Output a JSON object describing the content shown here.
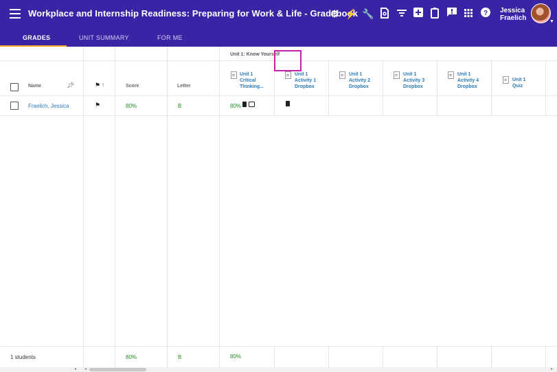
{
  "app": {
    "title": "Workplace and Internship Readiness: Preparing for Work & Life - Gradebook",
    "user_first": "Jessica",
    "user_last": "Fraelich"
  },
  "toolbar_icons": [
    "settings-icon",
    "lightning-icon",
    "wrench-icon",
    "search-doc-icon",
    "filter-icon",
    "add-box-icon",
    "clipboard-icon",
    "feedback-icon",
    "apps-grid-icon",
    "help-icon"
  ],
  "tabs": [
    {
      "label": "GRADES",
      "active": true
    },
    {
      "label": "UNIT SUMMARY",
      "active": false
    },
    {
      "label": "FOR ME",
      "active": false
    }
  ],
  "headers": {
    "name": "Name",
    "score": "Score",
    "letter": "Letter",
    "unit_group": "Unit 1: Know Yourself"
  },
  "columns": [
    {
      "label": "Unit 1 Critical Thinking...",
      "lines": [
        "Unit 1",
        "Critical",
        "Thinking..."
      ],
      "icon": "document-icon"
    },
    {
      "label": "Unit 1 Activity 1 Dropbox",
      "lines": [
        "Unit 1",
        "Activity 1",
        "Dropbox"
      ],
      "icon": "document-icon"
    },
    {
      "label": "Unit 1 Activity 2 Dropbox",
      "lines": [
        "Unit 1",
        "Activity 2",
        "Dropbox"
      ],
      "icon": "document-icon"
    },
    {
      "label": "Unit 1 Activity 3 Dropbox",
      "lines": [
        "Unit 1",
        "Activity 3",
        "Dropbox"
      ],
      "icon": "document-icon"
    },
    {
      "label": "Unit 1 Activity 4 Dropbox",
      "lines": [
        "Unit 1",
        "Activity 4",
        "Dropbox"
      ],
      "icon": "document-icon"
    },
    {
      "label": "Unit 1 Quiz",
      "lines": [
        "Unit 1",
        "Quiz"
      ],
      "icon": "quiz-icon"
    }
  ],
  "rows": [
    {
      "name": "Fraelich, Jessica",
      "score": "80%",
      "letter": "B",
      "critical_thinking": "80%"
    }
  ],
  "footer": {
    "count": "1 students",
    "score": "80%",
    "letter": "B",
    "critical_thinking": "80%"
  },
  "colors": {
    "header_bg": "#3b23a6",
    "accent_tab": "#f5a623",
    "grade_green": "#1e8e1e",
    "link_blue": "#2a7ab8",
    "highlight": "#c81fa8"
  }
}
